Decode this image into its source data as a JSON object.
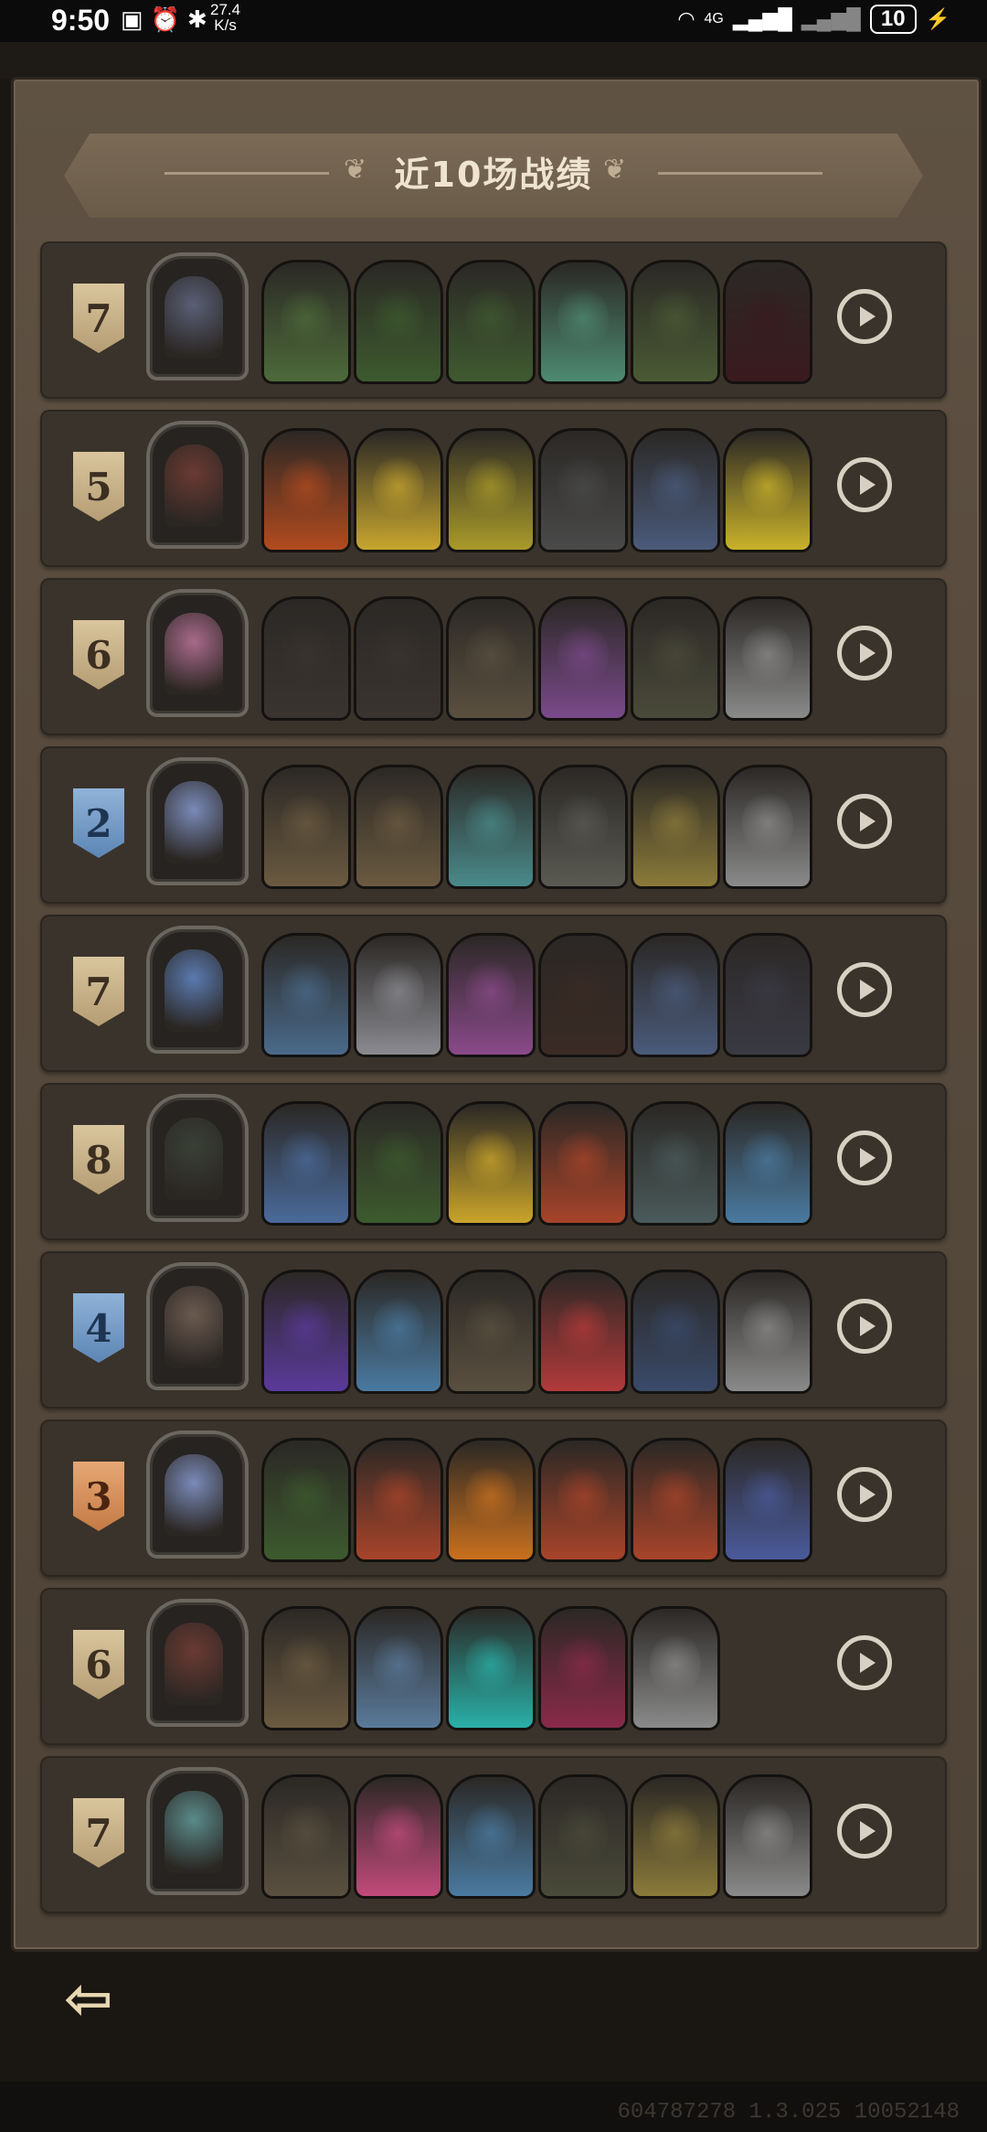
{
  "status_bar": {
    "time": "9:50",
    "speed_value": "27.4",
    "speed_unit": "K/s",
    "network": "4G",
    "battery": "10"
  },
  "title": "近10场战绩",
  "matches": [
    {
      "rank": "7",
      "rank_color": "tan",
      "hero_color": "#5a5f76",
      "units": [
        "#4d6a3a",
        "#3d5a2e",
        "#3f5a30",
        "#4e8a72",
        "#4a5a34",
        "#3a1a1e"
      ]
    },
    {
      "rank": "5",
      "rank_color": "tan",
      "hero_color": "#6a3a34",
      "units": [
        "#b24a1f",
        "#c7a62e",
        "#a99a2a",
        "#4a4a4a",
        "#4a5a7a",
        "#c9b22a"
      ]
    },
    {
      "rank": "6",
      "rank_color": "tan",
      "hero_color": "#a86a8a",
      "units": [
        "#3a3430",
        "#3a3430",
        "#5a5040",
        "#7a4a8a",
        "#4a4a3a",
        "#8a8a8a"
      ]
    },
    {
      "rank": "2",
      "rank_color": "blue",
      "hero_color": "#7a8ab8",
      "units": [
        "#6a5a40",
        "#6a5a40",
        "#4a8a8a",
        "#5a5a52",
        "#8a7a3a",
        "#8a8a8a"
      ]
    },
    {
      "rank": "7",
      "rank_color": "tan",
      "hero_color": "#5a7ab0",
      "units": [
        "#4a6a8a",
        "#8a8a90",
        "#8a4a8a",
        "#3a2a24",
        "#4a5a7a",
        "#3a3a44"
      ]
    },
    {
      "rank": "8",
      "rank_color": "tan",
      "hero_color": "#3a4036",
      "units": [
        "#4a6a9a",
        "#3d5a2e",
        "#c9a42a",
        "#a8442a",
        "#4a5a5a",
        "#4a7aa0"
      ]
    },
    {
      "rank": "4",
      "rank_color": "blue",
      "hero_color": "#6a5a50",
      "units": [
        "#5a3a9a",
        "#4a7aa0",
        "#5a5040",
        "#b23a3a",
        "#3a4a6a",
        "#8a8a8a"
      ]
    },
    {
      "rank": "3",
      "rank_color": "orange",
      "hero_color": "#7a8ab8",
      "units": [
        "#3d5a2e",
        "#a8442a",
        "#c9701e",
        "#a8442a",
        "#a8442a",
        "#4a5a9a"
      ]
    },
    {
      "rank": "6",
      "rank_color": "tan",
      "hero_color": "#6a3a34",
      "units": [
        "#6a5a40",
        "#5a7a9a",
        "#2ab0a8",
        "#8a2a4a",
        "#8a8a8a"
      ]
    },
    {
      "rank": "7",
      "rank_color": "tan",
      "hero_color": "#5a8a8a",
      "units": [
        "#5a5040",
        "#c24a7a",
        "#4a7aa0",
        "#4a4a3a",
        "#8a7a3a",
        "#8a8a8a"
      ]
    }
  ],
  "back_icon": "arrow-left-icon",
  "footer_id": "604787278 1.3.025 10052148"
}
